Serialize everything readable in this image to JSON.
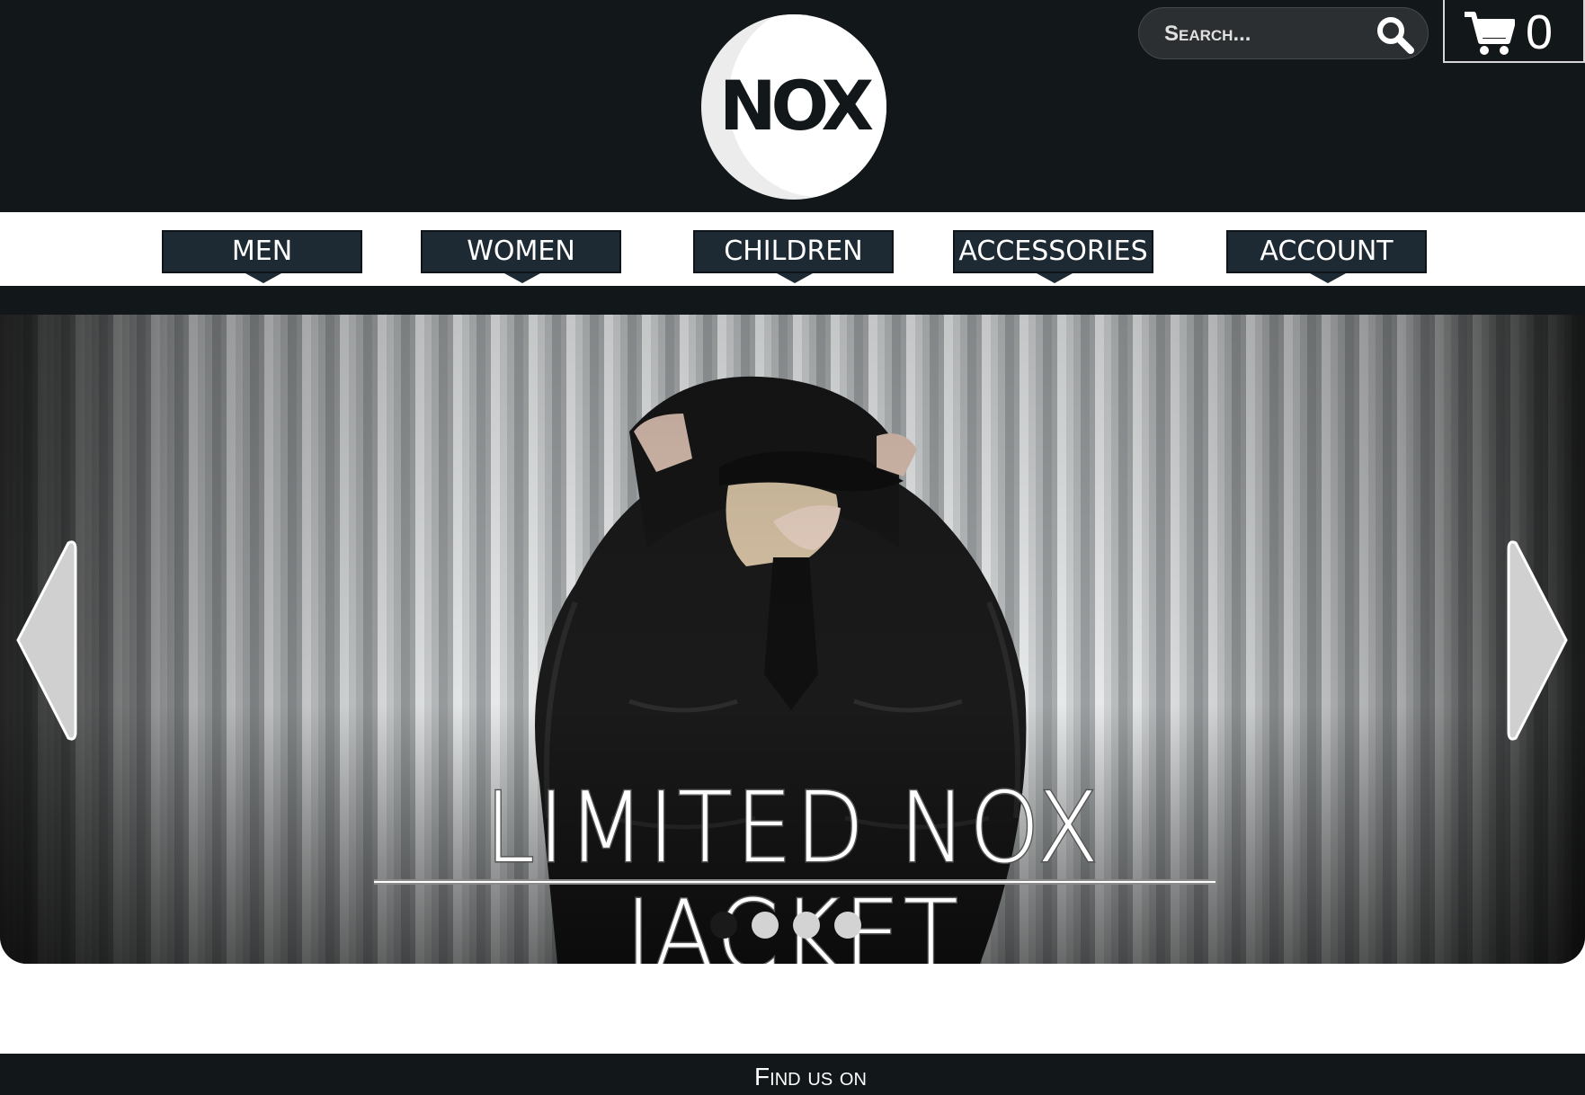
{
  "brand": {
    "logo_text": "NOX"
  },
  "search": {
    "placeholder": "Search..."
  },
  "cart": {
    "count": "0"
  },
  "nav": {
    "items": [
      {
        "label": "MEN"
      },
      {
        "label": "WOMEN"
      },
      {
        "label": "CHILDREN"
      },
      {
        "label": "ACCESSORIES"
      },
      {
        "label": "ACCOUNT"
      }
    ]
  },
  "hero": {
    "title": "LIMITED NOX JACKET",
    "slide_count": 4,
    "active_slide": 1
  },
  "footer": {
    "text": "Find us on"
  },
  "colors": {
    "header_bg": "#121719",
    "nav_button_bg": "#1e2a33",
    "page_bg": "#ffffff"
  },
  "icons": [
    "search-icon",
    "cart-icon",
    "arrow-left-icon",
    "arrow-right-icon"
  ]
}
